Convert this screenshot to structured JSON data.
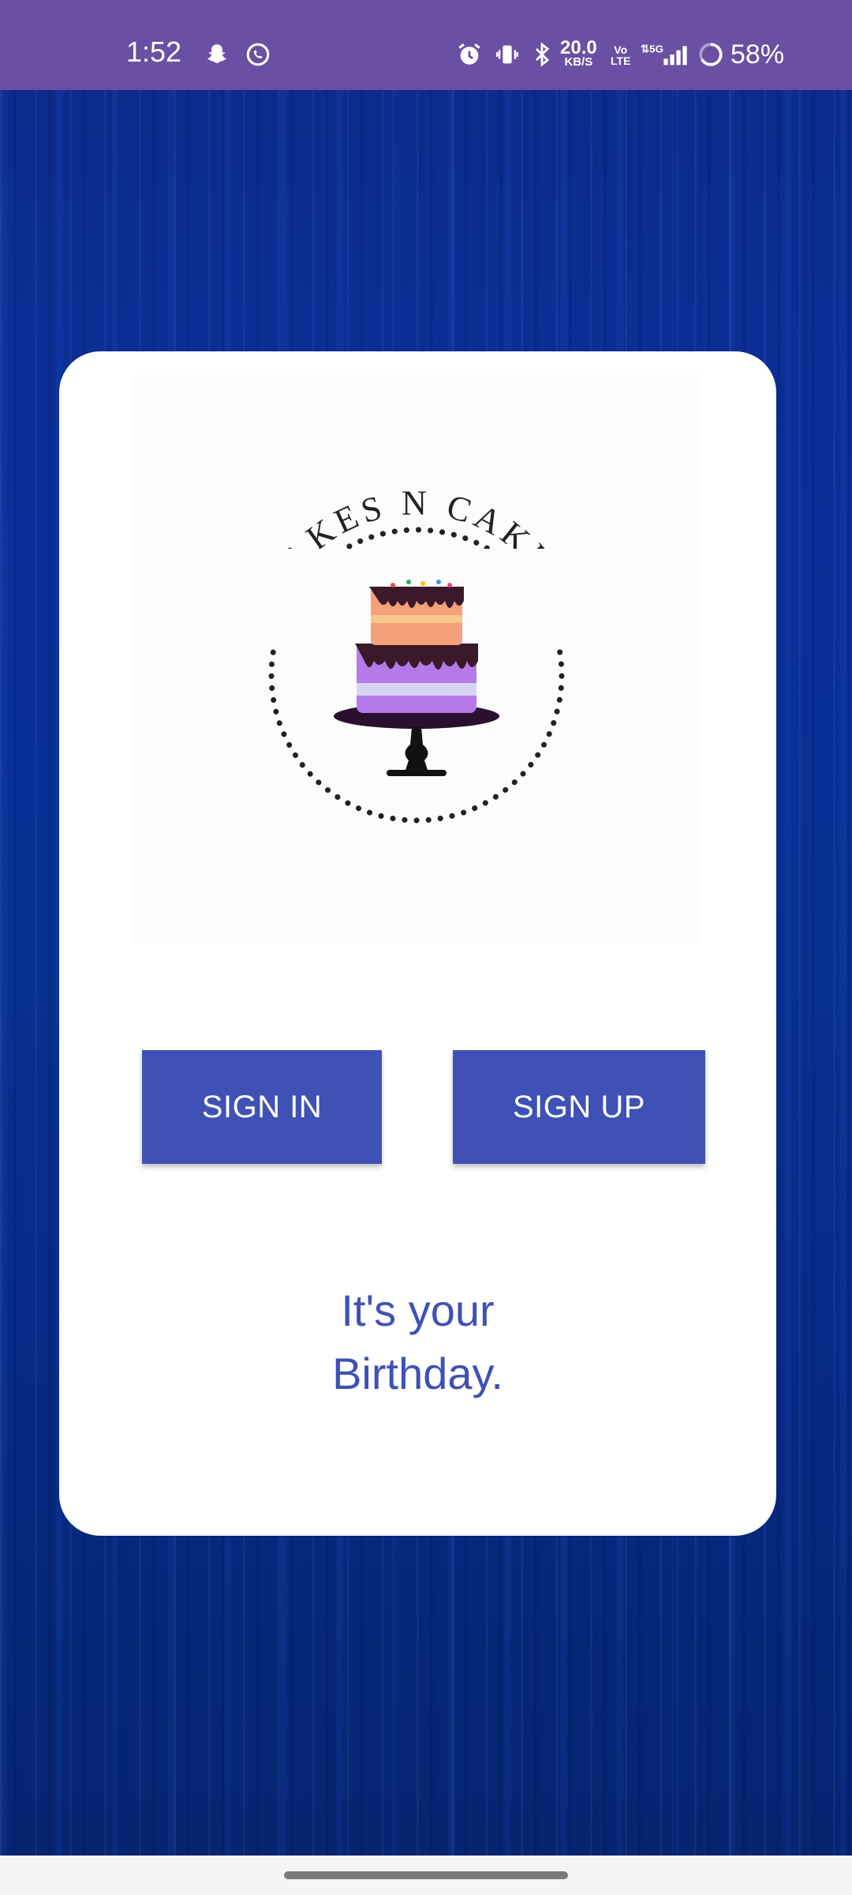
{
  "status_bar": {
    "time": "1:52",
    "network_speed": "20.0",
    "network_unit": "KB/S",
    "volte_top": "Vo",
    "volte_bottom": "LTE",
    "signal_label": "5G",
    "battery": "58%",
    "icons": [
      "snapchat-icon",
      "whatsapp-icon",
      "alarm-icon",
      "vibrate-icon",
      "bluetooth-icon",
      "signal-icon",
      "battery-icon"
    ]
  },
  "logo": {
    "text": "CAKES N CAKES"
  },
  "buttons": {
    "sign_in": "SIGN IN",
    "sign_up": "SIGN UP"
  },
  "tagline": {
    "line1": "It's your",
    "line2": "Birthday."
  },
  "colors": {
    "status_bar": "#6a4fa3",
    "primary": "#3f51b5",
    "background": "#0a2a8a",
    "card": "#ffffff"
  }
}
